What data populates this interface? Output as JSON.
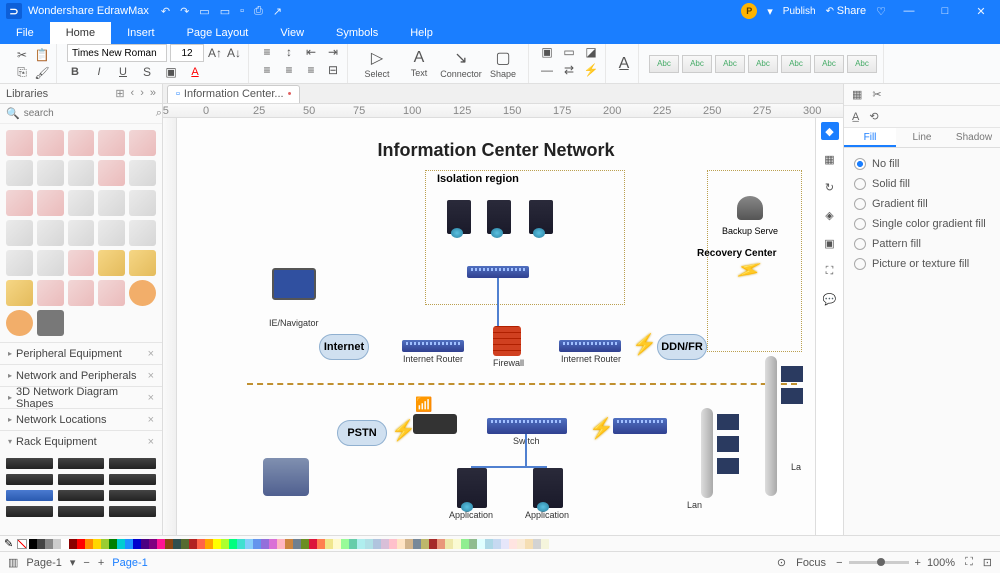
{
  "app": {
    "title": "Wondershare EdrawMax",
    "publish": "Publish",
    "share": "Share"
  },
  "menu": {
    "file": "File",
    "home": "Home",
    "insert": "Insert",
    "pagelayout": "Page Layout",
    "view": "View",
    "symbols": "Symbols",
    "help": "Help"
  },
  "ribbon": {
    "font": "Times New Roman",
    "size": "12",
    "select": "Select",
    "text": "Text",
    "connector": "Connector",
    "shape": "Shape",
    "style": "Abc"
  },
  "libs": {
    "header": "Libraries",
    "search_ph": "search",
    "cats": [
      "Peripheral Equipment",
      "Network and Peripherals",
      "3D Network Diagram Shapes",
      "Network Locations"
    ],
    "rack": "Rack Equipment"
  },
  "filetab": "Information Center...",
  "diagram": {
    "title": "Information Center Network",
    "isolation": "Isolation region",
    "recovery": "Recovery Center",
    "backup": "Backup Serve",
    "ie": "IE/Navigator",
    "internet": "Internet",
    "irouter": "Internet Router",
    "firewall": "Firewall",
    "ddn": "DDN/FR",
    "pstn": "PSTN",
    "switch": "Switch",
    "app": "Application",
    "lan": "Lan",
    "la": "La"
  },
  "proppanel": {
    "tabs": {
      "fill": "Fill",
      "line": "Line",
      "shadow": "Shadow"
    },
    "opts": [
      "No fill",
      "Solid fill",
      "Gradient fill",
      "Single color gradient fill",
      "Pattern fill",
      "Picture or texture fill"
    ]
  },
  "status": {
    "page": "Page-1",
    "pagenm": "Page-1",
    "focus": "Focus",
    "zoom": "100%"
  },
  "colors": [
    "#000",
    "#444",
    "#888",
    "#ccc",
    "#fff",
    "#8b0000",
    "#f00",
    "#ff8c00",
    "#ffd700",
    "#9acd32",
    "#008000",
    "#00ced1",
    "#1e90ff",
    "#0000cd",
    "#4b0082",
    "#800080",
    "#ff1493",
    "#8b4513",
    "#2f4f4f",
    "#556b2f",
    "#b22222",
    "#ff6347",
    "#ffa500",
    "#ffff00",
    "#adff2f",
    "#00ff7f",
    "#40e0d0",
    "#87cefa",
    "#6495ed",
    "#9370db",
    "#da70d6",
    "#ffb6c1",
    "#cd853f",
    "#708090",
    "#6b8e23",
    "#dc143c",
    "#ff7f50",
    "#f0e68c",
    "#fffacd",
    "#98fb98",
    "#66cdaa",
    "#afeeee",
    "#b0e0e6",
    "#b0c4de",
    "#d8bfd8",
    "#ffc0cb",
    "#ffe4c4",
    "#d2b48c",
    "#778899",
    "#bdb76b",
    "#a52a2a",
    "#e9967a",
    "#eee8aa",
    "#fafad2",
    "#90ee90",
    "#8fbc8f",
    "#e0ffff",
    "#add8e6",
    "#c6d9f1",
    "#e6e6fa",
    "#ffe4e1",
    "#faebd7",
    "#f5deb3",
    "#d3d3d3",
    "#f5f5dc"
  ]
}
